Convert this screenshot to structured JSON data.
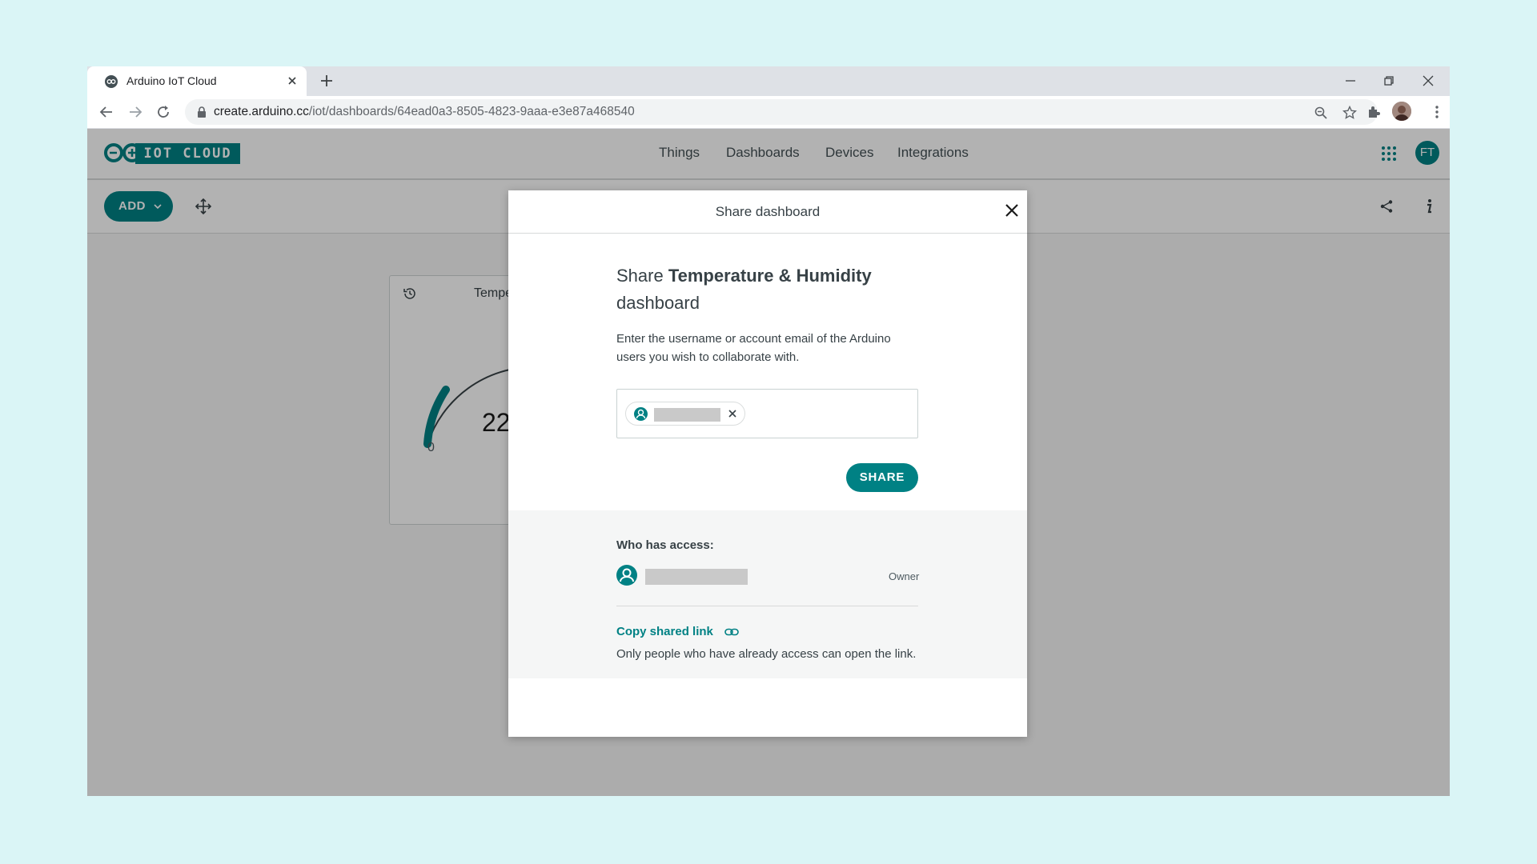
{
  "browser": {
    "tab_title": "Arduino IoT Cloud",
    "url_host": "create.arduino.cc",
    "url_path": "/iot/dashboards/64ead0a3-8505-4823-9aaa-e3e87a468540"
  },
  "app": {
    "logo_text": "IOT CLOUD",
    "nav": [
      "Things",
      "Dashboards",
      "Devices",
      "Integrations"
    ],
    "avatar_initials": "FT",
    "add_label": "ADD"
  },
  "widget": {
    "title": "Temperature",
    "value": "22",
    "min": "0"
  },
  "modal": {
    "title": "Share dashboard",
    "heading_prefix": "Share ",
    "heading_name": "Temperature & Humidity",
    "heading_suffix": "dashboard",
    "description": "Enter the username or account email of the Arduino users you wish to collaborate with.",
    "share_label": "SHARE",
    "access_label": "Who has access:",
    "owner_role": "Owner",
    "copy_link_label": "Copy shared link",
    "link_note": "Only people who have already access can open the link."
  },
  "colors": {
    "brand": "#008184",
    "page_bg": "#daf5f6"
  }
}
